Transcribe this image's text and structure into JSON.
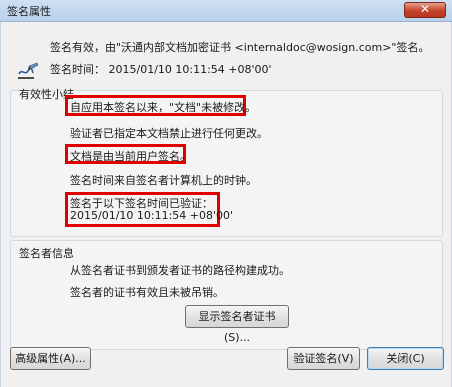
{
  "window": {
    "title": "签名属性"
  },
  "header": {
    "status_line": "签名有效，由\"沃通内部文档加密证书 <internaldoc@wosign.com>\"签名。",
    "signing_time": "签名时间：  2015/01/10 10:11:54 +08'00'"
  },
  "validity": {
    "title": "有效性小结",
    "items": [
      "自应用本签名以来，\"文档\"未被修改。",
      "验证者已指定本文档禁止进行任何更改。",
      "文档是由当前用户签名。",
      "签名时间来自签名者计算机上的时钟。",
      "签名于以下签名时间已验证：",
      "2015/01/10 10:11:54 +08'00'"
    ]
  },
  "signer_info": {
    "title": "签名者信息",
    "items": [
      "从签名者证书到颁发者证书的路径构建成功。",
      "签名者的证书有效且未被吊销。"
    ],
    "show_cert_button": "显示签名者证书(S)..."
  },
  "footer": {
    "advanced_button": "高级属性(A)...",
    "verify_button": "验证签名(V)",
    "close_button": "关闭(C)"
  },
  "icons": {
    "signature": "signature-pen-icon",
    "close": "close-icon"
  },
  "colors": {
    "highlight_border": "#e00000",
    "titlebar": "#c3d8ee",
    "close_button": "#c7432b"
  }
}
